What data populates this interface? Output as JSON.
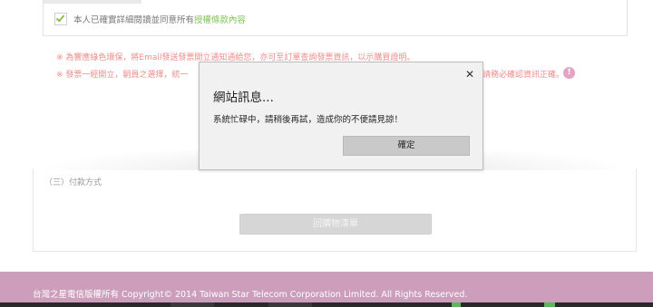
{
  "terms": {
    "agree_text": "本人已確實詳細閱讀並同意所有",
    "agree_link": "授權條款內容"
  },
  "notes": {
    "line1": "※ 為響應綠色環保，將Email發送發票開立通知通給您，亦可至訂單查詢發票資訊，以示購買證明。",
    "line2": "※ 發票一經開立，嗣員之選擇，統一",
    "line2_tail": "請務必確認資訊正確。",
    "info_icon": "info-icon"
  },
  "payment": {
    "section_title": "（三）付款方式",
    "back_button": "回購物清單"
  },
  "footer": {
    "copyright": "台灣之星電信版權所有 Copyright© 2014 Taiwan Star Telecom Corporation Limited. All Rights Reserved."
  },
  "dialog": {
    "title": "網站訊息...",
    "close_icon": "close-icon",
    "message": "系統忙碌中，請稍後再試，造成你的不便請見諒！",
    "ok_button": "確定"
  },
  "colors": {
    "notice_red": "#f08b8b",
    "link_green": "#7fc25a",
    "footer_pink": "#cc9ebc",
    "dialog_bg": "#f1f1f1"
  }
}
